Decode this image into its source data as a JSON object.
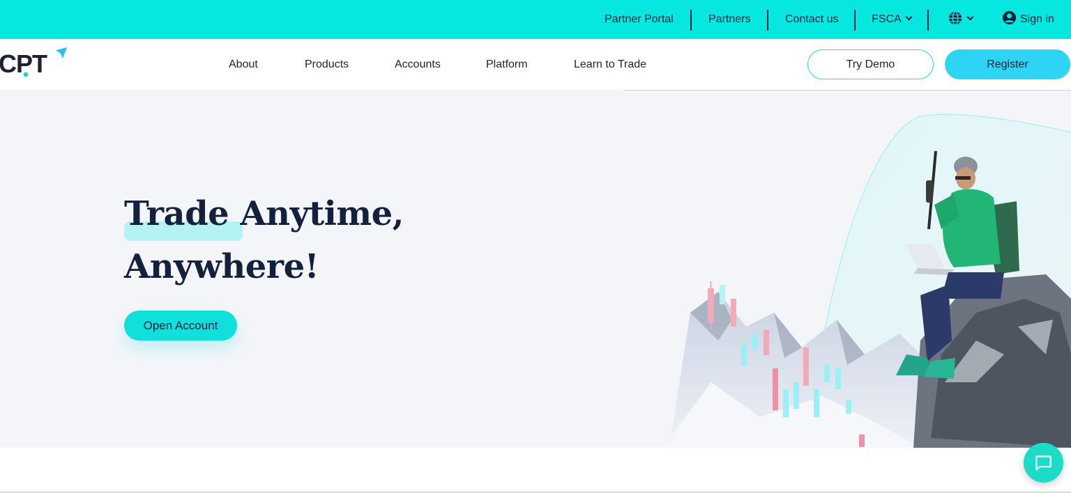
{
  "topbar": {
    "links": {
      "partner_portal": "Partner Portal",
      "partners": "Partners",
      "contact_us": "Contact us",
      "regulator": "FSCA",
      "sign_in": "Sign in"
    },
    "language_icon": "globe-icon",
    "user_icon": "user-circle-icon",
    "background_color": "#06e8df"
  },
  "nav": {
    "logo_text": "CPT",
    "items": {
      "about": "About",
      "products": "Products",
      "accounts": "Accounts",
      "platform": "Platform",
      "learn": "Learn to Trade"
    },
    "try_demo": "Try Demo",
    "register": "Register"
  },
  "hero": {
    "headline_line1": "Trade Anytime,",
    "headline_line2": "Anywhere!",
    "cta": "Open Account",
    "accent_color": "#0fe0dc",
    "highlight_color": "#b3f4f2"
  },
  "chat": {
    "icon": "chat-bubble-icon",
    "color": "#1cdcc8"
  }
}
